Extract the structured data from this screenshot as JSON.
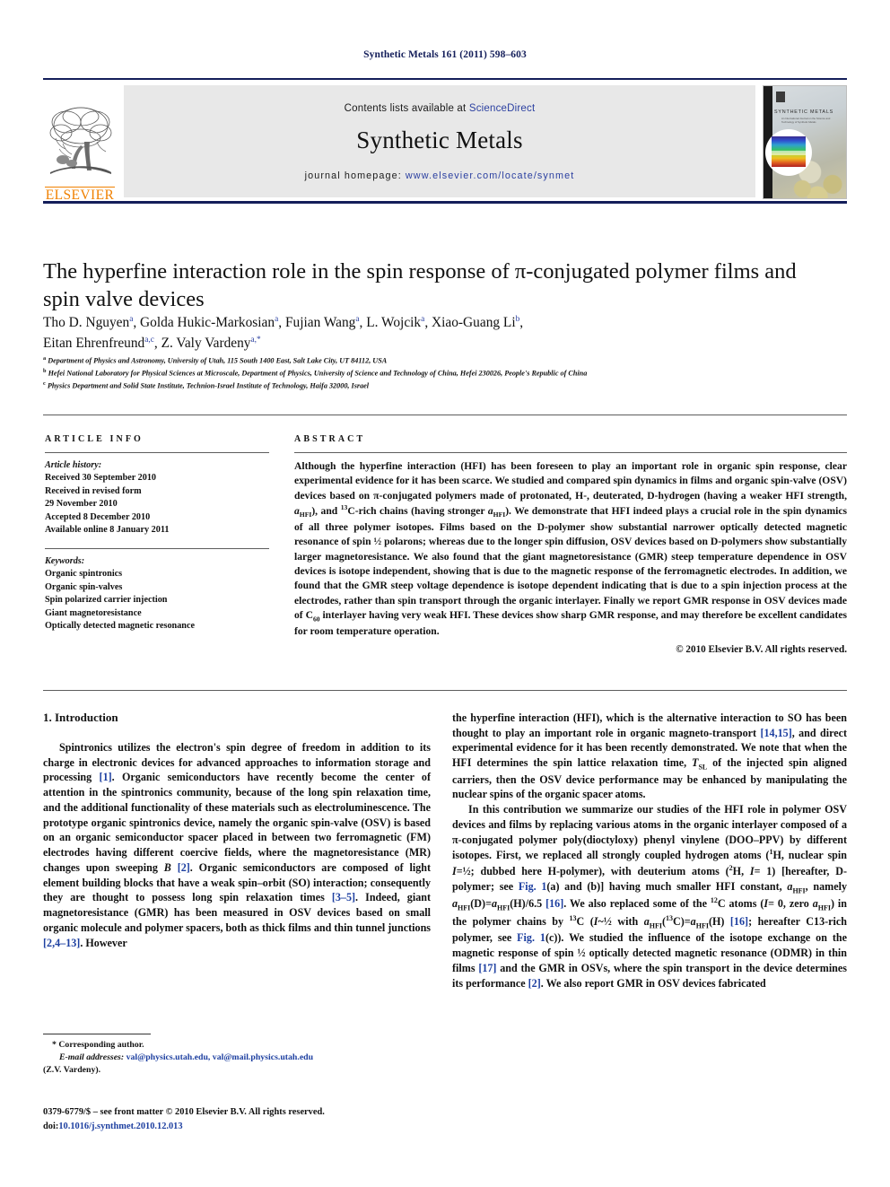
{
  "running_head": "Synthetic Metals 161 (2011) 598–603",
  "masthead": {
    "contents_prefix": "Contents lists available at ",
    "sciencedirect": "ScienceDirect",
    "journal_name": "Synthetic Metals",
    "homepage_prefix": "journal homepage: ",
    "homepage_url": "www.elsevier.com/locate/synmet",
    "publisher_wordmark": "ELSEVIER",
    "cover_title": "SYNTHETIC METALS",
    "cover_subtitle": "An International Journal on the Science and Technology of Synthetic Metals"
  },
  "article": {
    "title": "The hyperfine interaction role in the spin response of π-conjugated polymer films and spin valve devices",
    "authors_line1": "Tho D. Nguyen<sup>a</sup>, Golda Hukic-Markosian<sup>a</sup>, Fujian Wang<sup>a</sup>, L. Wojcik<sup>a</sup>, Xiao-Guang Li<sup>b</sup>,",
    "authors_line2": "Eitan Ehrenfreund<sup>a,c</sup>, Z. Valy Vardeny<sup>a,</sup><sup>*</sup>",
    "affiliations": [
      "<span class=\"mark\">a</span> Department of Physics and Astronomy, University of Utah, 115 South 1400 East, Salt Lake City, UT 84112, USA",
      "<span class=\"mark\">b</span> Hefei National Laboratory for Physical Sciences at Microscale, Department of Physics, University of Science and Technology of China, Hefei 230026, People's Republic of China",
      "<span class=\"mark\">c</span> Physics Department and Solid State Institute, Technion-Israel Institute of Technology, Haifa 32000, Israel"
    ]
  },
  "article_info": {
    "heading": "ARTICLE INFO",
    "history_label": "Article history:",
    "history": [
      "Received 30 September 2010",
      "Received in revised form",
      "29 November 2010",
      "Accepted 8 December 2010",
      "Available online 8 January 2011"
    ],
    "keywords_label": "Keywords:",
    "keywords": [
      "Organic spintronics",
      "Organic spin-valves",
      "Spin polarized carrier injection",
      "Giant magnetoresistance",
      "Optically detected magnetic resonance"
    ]
  },
  "abstract": {
    "heading": "ABSTRACT",
    "body": "Although the hyperfine interaction (HFI) has been foreseen to play an important role in organic spin response, clear experimental evidence for it has been scarce. We studied and compared spin dynamics in films and organic spin-valve (OSV) devices based on π-conjugated polymers made of protonated, H-, deuterated, D-hydrogen (having a weaker HFI strength, <i>a</i><sub>HFI</sub>), and <sup>13</sup>C-rich chains (having stronger <i>a</i><sub>HFI</sub>). We demonstrate that HFI indeed plays a crucial role in the spin dynamics of all three polymer isotopes. Films based on the D-polymer show substantial narrower optically detected magnetic resonance of spin ½ polarons; whereas due to the longer spin diffusion, OSV devices based on D-polymers show substantially larger magnetoresistance. We also found that the giant magnetoresistance (GMR) steep temperature dependence in OSV devices is isotope independent, showing that is due to the magnetic response of the ferromagnetic electrodes. In addition, we found that the GMR steep voltage dependence is isotope dependent indicating that is due to a spin injection process at the electrodes, rather than spin transport through the organic interlayer. Finally we report GMR response in OSV devices made of C<sub>60</sub> interlayer having very weak HFI. These devices show sharp GMR response, and may therefore be excellent candidates for room temperature operation.",
    "copyright": "© 2010 Elsevier B.V. All rights reserved."
  },
  "introduction": {
    "heading": "1. Introduction",
    "left_p1": "Spintronics utilizes the electron's spin degree of freedom in addition to its charge in electronic devices for advanced approaches to information storage and processing <span class=\"ref\">[1]</span>. Organic semiconductors have recently become the center of attention in the spintronics community, because of the long spin relaxation time, and the additional functionality of these materials such as electroluminescence. The prototype organic spintronics device, namely the organic spin-valve (OSV) is based on an organic semiconductor spacer placed in between two ferromagnetic (FM) electrodes having different coercive fields, where the magnetoresistance (MR) changes upon sweeping <i>B</i> <span class=\"ref\">[2]</span>. Organic semiconductors are composed of light element building blocks that have a weak spin–orbit (SO) interaction; consequently they are thought to possess long spin relaxation times <span class=\"ref\">[3–5]</span>. Indeed, giant magnetoresistance (GMR) has been measured in OSV devices based on small organic molecule and polymer spacers, both as thick films and thin tunnel junctions <span class=\"ref\">[2,4–13]</span>. However",
    "right_p1": "the hyperfine interaction (HFI), which is the alternative interaction to SO has been thought to play an important role in organic magneto-transport <span class=\"ref\">[14,15]</span>, and direct experimental evidence for it has been recently demonstrated. We note that when the HFI determines the spin lattice relaxation time, <i>T</i><sub>SL</sub> of the injected spin aligned carriers, then the OSV device performance may be enhanced by manipulating the nuclear spins of the organic spacer atoms.",
    "right_p2": "In this contribution we summarize our studies of the HFI role in polymer OSV devices and films by replacing various atoms in the organic interlayer composed of a π-conjugated polymer poly(dioctyloxy) phenyl vinylene (DOO–PPV) by different isotopes. First, we replaced all strongly coupled hydrogen atoms (<sup>1</sup>H, nuclear spin <i>I</i>=½; dubbed here H-polymer), with deuterium atoms (<sup>2</sup>H, <i>I</i>= 1) [hereafter, D-polymer; see <span class=\"ref\">Fig. 1</span>(a) and (b)] having much smaller HFI constant, <i>a</i><sub>HFI</sub>, namely <i>a</i><sub>HFI</sub>(D)=<i>a</i><sub>HFI</sub>(H)/6.5 <span class=\"ref\">[16]</span>. We also replaced some of the <sup>12</sup>C atoms (<i>I</i>= 0, zero <i>a</i><sub>HFI</sub>) in the polymer chains by <sup>13</sup>C (<i>I</i>~½ with <i>a</i><sub>HFI</sub>(<sup>13</sup>C)=<i>a</i><sub>HFI</sub>(H) <span class=\"ref\">[16]</span>; hereafter C13-rich polymer, see <span class=\"ref\">Fig. 1</span>(c)). We studied the influence of the isotope exchange on the magnetic response of spin ½ optically detected magnetic resonance (ODMR) in thin films <span class=\"ref\">[17]</span> and the GMR in OSVs, where the spin transport in the device determines its performance <span class=\"ref\">[2]</span>. We also report GMR in OSV devices fabricated"
  },
  "footnote": {
    "corresponding": "* Corresponding author.",
    "email_label": "E-mail addresses:",
    "emails": "val@physics.utah.edu, val@mail.physics.utah.edu",
    "attribution": "(Z.V. Vardeny)."
  },
  "imprint": {
    "line1": "0379-6779/$ – see front matter © 2010 Elsevier B.V. All rights reserved.",
    "doi_label": "doi:",
    "doi_value": "10.1016/j.synthmet.2010.12.013"
  },
  "colors": {
    "link": "#1d3fa0",
    "rule": "#141e5a",
    "elsevier_orange": "#f08000"
  }
}
